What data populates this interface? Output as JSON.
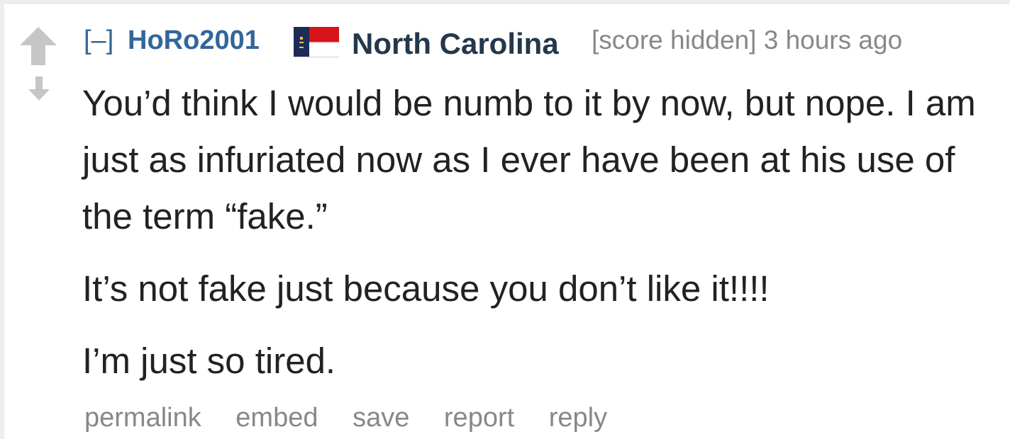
{
  "comment": {
    "collapse_label": "[–]",
    "author": "HoRo2001",
    "flair_text": "North Carolina",
    "score": "[score hidden]",
    "time": "3 hours ago",
    "paragraphs": [
      "You’d think I would be numb to it by now, but nope. I am just as infuriated now as I ever have been at his use of the term “fake.”",
      "It’s not fake just because you don’t like it!!!!",
      "I’m just so tired."
    ],
    "actions": {
      "permalink": "permalink",
      "embed": "embed",
      "save": "save",
      "report": "report",
      "reply": "reply"
    }
  },
  "icons": {
    "upvote": "upvote-arrow-icon",
    "downvote": "downvote-arrow-icon",
    "flair": "north-carolina-flag-icon"
  },
  "colors": {
    "link": "#336699",
    "flair": "#24384b",
    "muted": "#888888",
    "arrow": "#c6c6c6"
  }
}
